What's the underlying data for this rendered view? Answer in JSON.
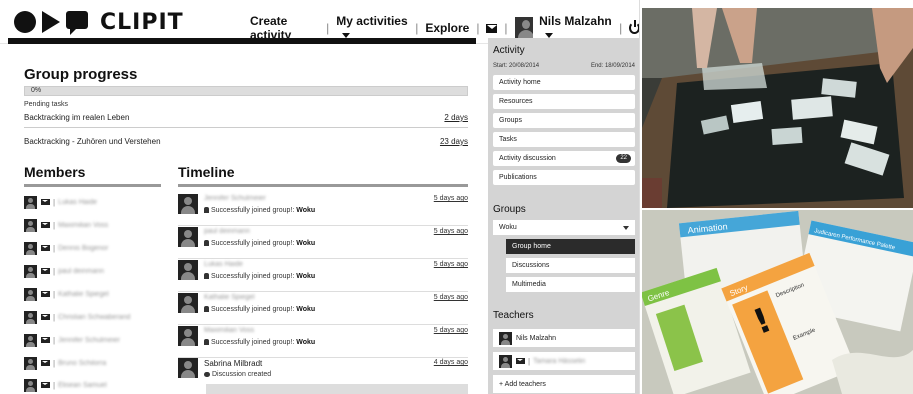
{
  "header": {
    "logo_text": "CLIPIT",
    "nav_create": "Create activity",
    "nav_my": "My activities",
    "nav_explore": "Explore",
    "user_name": "Nils Malzahn"
  },
  "group_progress": {
    "title": "Group progress",
    "progress_label": "0%",
    "progress_value": 0,
    "pending_label": "Pending tasks",
    "tasks": [
      {
        "name": "Backtracking im realen Leben",
        "due": "2 days"
      },
      {
        "name": "Backtracking - Zuhören und Verstehen",
        "due": "23 days"
      }
    ]
  },
  "members": {
    "title": "Members",
    "items": [
      {
        "name": "Lukas Haide"
      },
      {
        "name": "Maximilian Voss"
      },
      {
        "name": "Dennis Bogenor"
      },
      {
        "name": "paul deinmann"
      },
      {
        "name": "Kathalie Spiegel"
      },
      {
        "name": "Christian Schwaberand"
      },
      {
        "name": "Jennifer Schulmeier"
      },
      {
        "name": "Bruno Schilorra"
      },
      {
        "name": "Elisean Samuel"
      }
    ]
  },
  "timeline": {
    "title": "Timeline",
    "items": [
      {
        "name": "Jennifer Schulmeier",
        "action": "Successfully joined group!: ",
        "group": "Woku",
        "time": "5 days ago"
      },
      {
        "name": "paul deinmann",
        "action": "Successfully joined group!: ",
        "group": "Woku",
        "time": "5 days ago"
      },
      {
        "name": "Lukas Haide",
        "action": "Successfully joined group!: ",
        "group": "Woku",
        "time": "5 days ago"
      },
      {
        "name": "Kathalie Spiegel",
        "action": "Successfully joined group!: ",
        "group": "Woku",
        "time": "5 days ago"
      },
      {
        "name": "Maximilian Voss",
        "action": "Successfully joined group!: ",
        "group": "Woku",
        "time": "5 days ago"
      },
      {
        "name": "Sabrina Milbradt",
        "action": "Discussion created",
        "group": "",
        "time": "4 days ago"
      }
    ]
  },
  "sidebar": {
    "activity_title": "Activity",
    "start": "Start: 20/08/2014",
    "end": "End: 18/09/2014",
    "activity_items": [
      {
        "label": "Activity home"
      },
      {
        "label": "Resources"
      },
      {
        "label": "Groups"
      },
      {
        "label": "Tasks"
      },
      {
        "label": "Activity discussion",
        "badge": "22"
      },
      {
        "label": "Publications"
      }
    ],
    "groups_title": "Groups",
    "group_selected": "Woku",
    "group_items": [
      {
        "label": "Group home"
      },
      {
        "label": "Discussions"
      },
      {
        "label": "Multimedia"
      }
    ],
    "teachers_title": "Teachers",
    "teachers": [
      {
        "name": "Nils Malzahn"
      },
      {
        "name": "Tamara Hässelin"
      }
    ],
    "add_teachers": "+ Add teachers"
  },
  "photos": {
    "table_colors": {
      "wood": "#5e4a36",
      "screen": "#1c2220"
    },
    "cards": {
      "card_blue_title": "Animation",
      "card_orange_title": "Story",
      "card_green_title": "Genre",
      "card_right_title": "Judicaren Performance Palette",
      "description_label": "Description",
      "example_label": "Example"
    }
  }
}
